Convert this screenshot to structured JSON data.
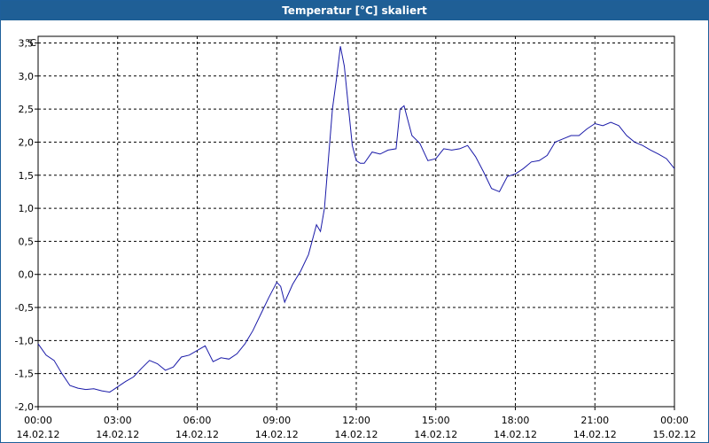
{
  "window": {
    "title": "Temperatur [°C] skaliert"
  },
  "chart_data": {
    "type": "line",
    "title": "Temperatur [°C] skaliert",
    "ylabel": "°C",
    "ylim": [
      -2.0,
      3.6
    ],
    "yticks": [
      {
        "value": 3.5,
        "label": "3,5"
      },
      {
        "value": 3.0,
        "label": "3,0"
      },
      {
        "value": 2.5,
        "label": "2,5"
      },
      {
        "value": 2.0,
        "label": "2,0"
      },
      {
        "value": 1.5,
        "label": "1,5"
      },
      {
        "value": 1.0,
        "label": "1,0"
      },
      {
        "value": 0.5,
        "label": "0,5"
      },
      {
        "value": 0.0,
        "label": "0,0"
      },
      {
        "value": -0.5,
        "label": "-0,5"
      },
      {
        "value": -1.0,
        "label": "-1,0"
      },
      {
        "value": -1.5,
        "label": "-1,5"
      },
      {
        "value": -2.0,
        "label": "-2,0"
      }
    ],
    "xlim": [
      0,
      24
    ],
    "xticks": [
      {
        "hours": 0,
        "time": "00:00",
        "date": "14.02.12"
      },
      {
        "hours": 3,
        "time": "03:00",
        "date": "14.02.12"
      },
      {
        "hours": 6,
        "time": "06:00",
        "date": "14.02.12"
      },
      {
        "hours": 9,
        "time": "09:00",
        "date": "14.02.12"
      },
      {
        "hours": 12,
        "time": "12:00",
        "date": "14.02.12"
      },
      {
        "hours": 15,
        "time": "15:00",
        "date": "14.02.12"
      },
      {
        "hours": 18,
        "time": "18:00",
        "date": "14.02.12"
      },
      {
        "hours": 21,
        "time": "21:00",
        "date": "14.02.12"
      },
      {
        "hours": 24,
        "time": "00:00",
        "date": "15.02.12"
      }
    ],
    "grid": true,
    "line_color": "#1a1aa8",
    "series": [
      {
        "x": [
          0.0,
          0.3,
          0.6,
          0.9,
          1.2,
          1.5,
          1.8,
          2.1,
          2.4,
          2.7,
          3.0,
          3.3,
          3.6,
          3.9,
          4.2,
          4.5,
          4.8,
          5.1,
          5.4,
          5.7,
          6.0,
          6.3,
          6.6,
          6.9,
          7.2,
          7.5,
          7.8,
          8.1,
          8.4,
          8.7,
          9.0,
          9.15,
          9.3,
          9.6,
          9.9,
          10.2,
          10.5,
          10.65,
          10.8,
          11.1,
          11.25,
          11.4,
          11.55,
          11.7,
          11.85,
          12.0,
          12.15,
          12.3,
          12.6,
          12.9,
          13.2,
          13.5,
          13.65,
          13.8,
          14.1,
          14.4,
          14.7,
          15.0,
          15.3,
          15.6,
          15.9,
          16.2,
          16.5,
          16.8,
          17.1,
          17.4,
          17.7,
          18.0,
          18.3,
          18.6,
          18.9,
          19.2,
          19.5,
          19.8,
          20.1,
          20.4,
          20.7,
          21.0,
          21.3,
          21.6,
          21.9,
          22.2,
          22.5,
          22.8,
          23.1,
          23.4,
          23.7,
          24.0
        ],
        "y": [
          -1.05,
          -1.22,
          -1.3,
          -1.5,
          -1.68,
          -1.72,
          -1.74,
          -1.73,
          -1.76,
          -1.78,
          -1.7,
          -1.62,
          -1.55,
          -1.42,
          -1.3,
          -1.35,
          -1.45,
          -1.4,
          -1.25,
          -1.22,
          -1.15,
          -1.08,
          -1.32,
          -1.26,
          -1.28,
          -1.2,
          -1.05,
          -0.85,
          -0.6,
          -0.35,
          -0.12,
          -0.18,
          -0.42,
          -0.15,
          0.05,
          0.3,
          0.75,
          0.65,
          1.0,
          2.5,
          2.95,
          3.45,
          3.15,
          2.55,
          1.95,
          1.72,
          1.68,
          1.68,
          1.85,
          1.82,
          1.88,
          1.9,
          2.5,
          2.55,
          2.1,
          1.98,
          1.72,
          1.75,
          1.9,
          1.88,
          1.9,
          1.95,
          1.78,
          1.55,
          1.3,
          1.25,
          1.48,
          1.52,
          1.6,
          1.7,
          1.72,
          1.8,
          2.0,
          2.05,
          2.1,
          2.1,
          2.2,
          2.28,
          2.25,
          2.3,
          2.25,
          2.1,
          2.0,
          1.95,
          1.88,
          1.82,
          1.75,
          1.6
        ]
      }
    ]
  }
}
